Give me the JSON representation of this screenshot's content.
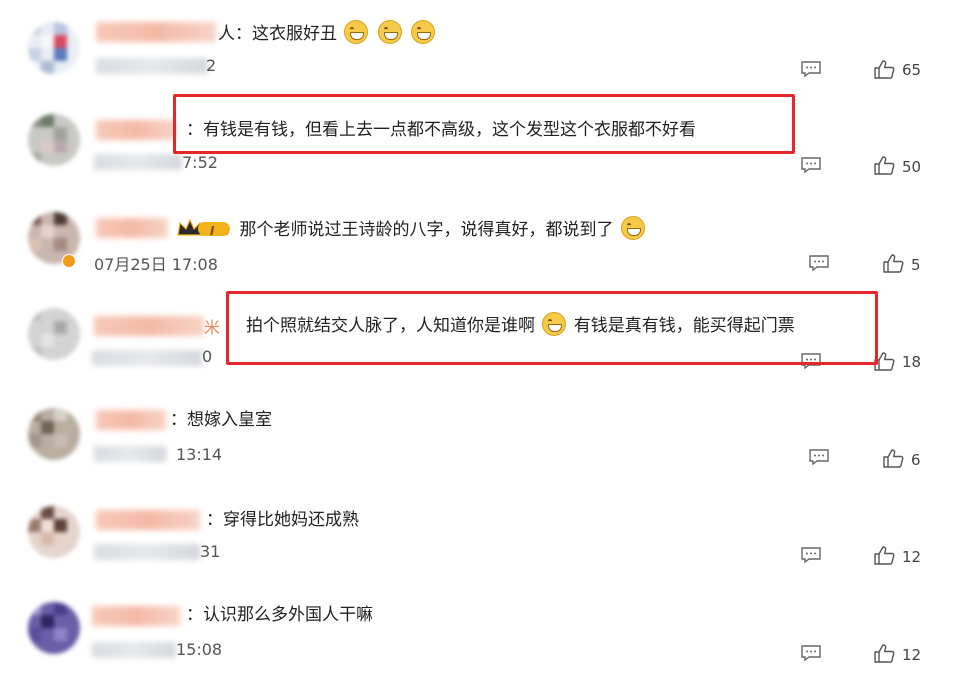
{
  "comments": [
    {
      "name_suffix": "人：",
      "text": "这衣服好丑",
      "time": "2",
      "likes": "65",
      "emojis": 3
    },
    {
      "name_suffix": "：",
      "text": "有钱是有钱，但看上去一点都不高级，这个发型这个衣服都不好看",
      "time": "7:52",
      "likes": "50"
    },
    {
      "name_suffix": "：",
      "text": "那个老师说过王诗龄的八字，说得真好，都说到了",
      "time": "07月25日 17:08",
      "likes": "5",
      "badge_label": "I"
    },
    {
      "name_suffix": "米",
      "text_a": "拍个照就结交人脉了，人知道你是谁啊",
      "text_b": "有钱是真有钱，能买得起门票",
      "time": "0",
      "likes": "18"
    },
    {
      "name_suffix": "：",
      "text": "想嫁入皇室",
      "time": "13:14",
      "likes": "6"
    },
    {
      "name_suffix": "：",
      "text": "穿得比她妈还成熟",
      "time": "31",
      "likes": "12"
    },
    {
      "name_suffix": "：",
      "text": "认识那么多外国人干嘛",
      "time": "15:08",
      "likes": "12"
    }
  ],
  "colors": {
    "highlight": "#e5262a",
    "text": "#222222",
    "meta": "#555555"
  },
  "icons": {
    "reply": "comment-bubble-icon",
    "like": "thumbs-up-icon"
  }
}
